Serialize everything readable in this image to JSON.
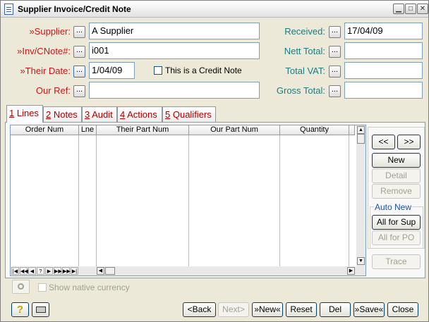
{
  "window": {
    "title": "Supplier Invoice/Credit Note"
  },
  "form": {
    "supplier_label": "»Supplier:",
    "supplier_value": "A Supplier",
    "inv_label": "»Inv/CNote#:",
    "inv_value": "i001",
    "their_date_label": "»Their Date:",
    "their_date_value": "1/04/09",
    "credit_note_label": "This is a Credit Note",
    "our_ref_label": "Our Ref:",
    "our_ref_value": "",
    "received_label": "Received:",
    "received_value": "17/04/09",
    "nett_total_label": "Nett Total:",
    "nett_total_value": "",
    "total_vat_label": "Total VAT:",
    "total_vat_value": "",
    "gross_total_label": "Gross Total:",
    "gross_total_value": "",
    "dots_label": "..."
  },
  "tabs": [
    {
      "num": "1",
      "label": " Lines"
    },
    {
      "num": "2",
      "label": " Notes"
    },
    {
      "num": "3",
      "label": " Audit"
    },
    {
      "num": "4",
      "label": " Actions"
    },
    {
      "num": "5",
      "label": " Qualifiers"
    }
  ],
  "grid": {
    "columns": [
      "Order Num",
      "Lne",
      "Their Part Num",
      "Our Part Num",
      "Quantity"
    ]
  },
  "side": {
    "prev": "<<",
    "next": ">>",
    "new": "New",
    "detail": "Detail",
    "remove": "Remove",
    "auto_new": "Auto New",
    "all_for_sup": "All for Sup",
    "all_for_po": "All for PO",
    "trace": "Trace"
  },
  "show_native_currency": "Show native currency",
  "footer": {
    "back": "<Back",
    "next": "Next>",
    "new": "»New«",
    "reset": "Reset",
    "del": "Del",
    "save": "»Save«",
    "close": "Close"
  }
}
